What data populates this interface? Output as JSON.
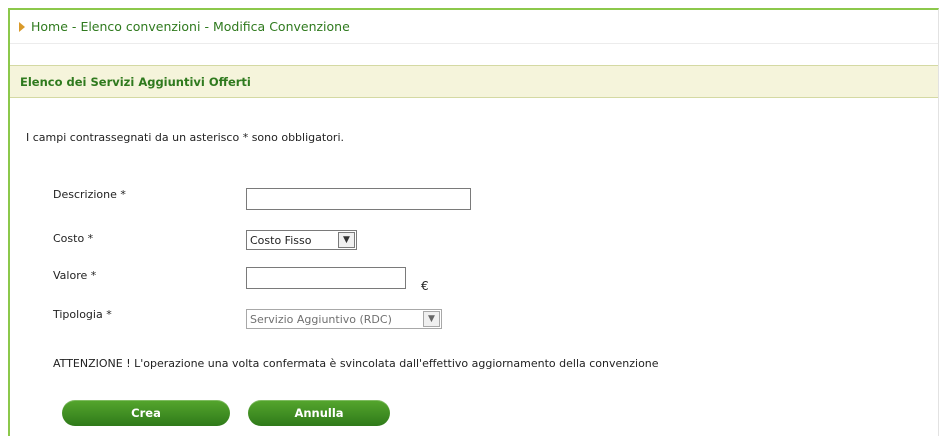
{
  "breadcrumb": {
    "items": [
      "Home",
      "Elenco convenzioni",
      "Modifica Convenzione"
    ],
    "separator": "-"
  },
  "section": {
    "title": "Elenco dei Servizi Aggiuntivi Offerti"
  },
  "form": {
    "required_note": "I campi contrassegnati da un asterisco * sono obbligatori.",
    "descrizione": {
      "label": "Descrizione *",
      "value": ""
    },
    "costo": {
      "label": "Costo *",
      "selected": "Costo Fisso"
    },
    "valore": {
      "label": "Valore *",
      "value": "",
      "currency": "€"
    },
    "tipologia": {
      "label": "Tipologia *",
      "selected": "Servizio Aggiuntivo (RDC)"
    },
    "warning": "ATTENZIONE ! L'operazione una volta confermata è svincolata dall'effettivo aggiornamento della convenzione"
  },
  "buttons": {
    "create": "Crea",
    "cancel": "Annulla"
  },
  "colors": {
    "accent": "#2f7a1e",
    "button": "#3f8f22",
    "section_bg": "#f5f4db",
    "frame": "#8cc84b"
  },
  "icons": {
    "breadcrumb_marker": "triangle-right-icon",
    "dropdown": "chevron-down-icon"
  }
}
